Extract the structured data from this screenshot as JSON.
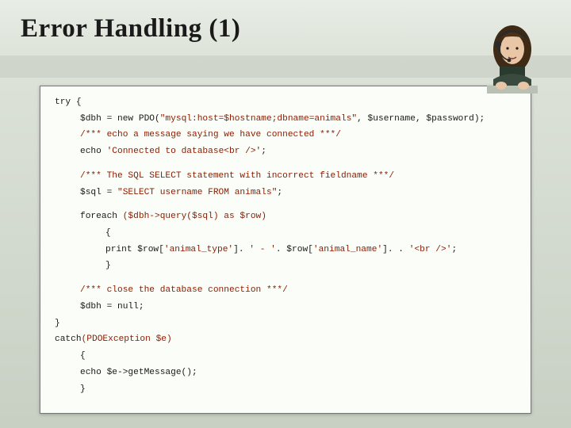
{
  "title": "Error Handling (1)",
  "code": {
    "l01": "try {",
    "l02a": "$dbh = new PDO(",
    "l02b": "\"mysql:host=$hostname;dbname=animals\"",
    "l02c": ", $username, $password);",
    "l03": "/*** echo a message saying we have connected ***/",
    "l04a": "echo ",
    "l04b": "'Connected to database<br />'",
    "l04c": ";",
    "l05": "/*** The SQL SELECT statement with incorrect fieldname ***/",
    "l06a": "$sql = ",
    "l06b": "\"SELECT username FROM animals\"",
    "l06c": ";",
    "l07a": "foreach ",
    "l07b": "($dbh->query($sql) as $row)",
    "l08": "{",
    "l09a": "print $row[",
    "l09b": "'animal_type'",
    "l09c": "]. ",
    "l09d": "' - '",
    "l09e": ". $row[",
    "l09f": "'animal_name'",
    "l09g": "]. . ",
    "l09h": "'<br />'",
    "l09i": ";",
    "l10": "}",
    "l11": "/*** close the database connection ***/",
    "l12": "$dbh = null;",
    "l13": "}",
    "l14a": "catch",
    "l14b": "(PDOException $e)",
    "l15": "{",
    "l16": "echo $e->getMessage();",
    "l17": "}"
  }
}
